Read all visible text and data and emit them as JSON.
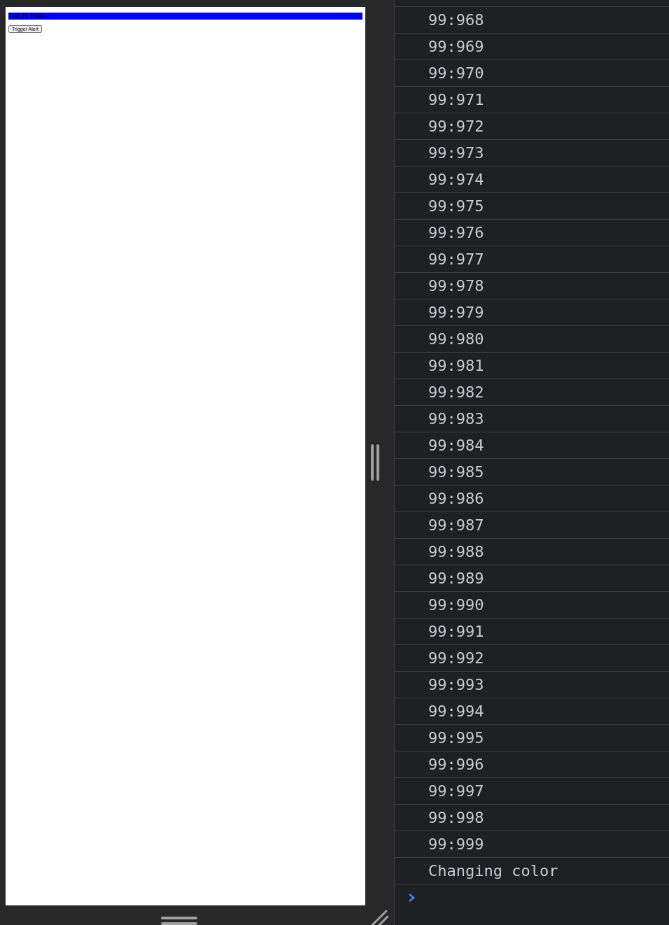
{
  "preview": {
    "banner": "Test JS Hello",
    "button": "Trigger Alert"
  },
  "console": {
    "entries": [
      "99:968",
      "99:969",
      "99:970",
      "99:971",
      "99:972",
      "99:973",
      "99:974",
      "99:975",
      "99:976",
      "99:977",
      "99:978",
      "99:979",
      "99:980",
      "99:981",
      "99:982",
      "99:983",
      "99:984",
      "99:985",
      "99:986",
      "99:987",
      "99:988",
      "99:989",
      "99:990",
      "99:991",
      "99:992",
      "99:993",
      "99:994",
      "99:995",
      "99:996",
      "99:997",
      "99:998",
      "99:999",
      "Changing color"
    ]
  }
}
